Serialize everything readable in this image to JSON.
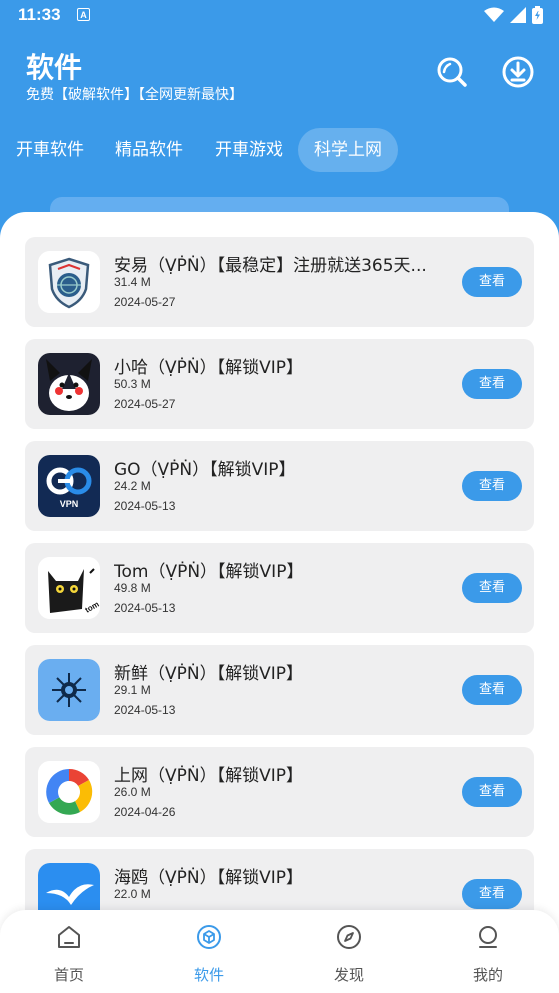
{
  "status": {
    "time": "11:33"
  },
  "header": {
    "title": "软件",
    "subtitle": "免费【破解软件】【全网更新最快】",
    "accent": "#3b9ae9"
  },
  "tabs": [
    {
      "label": "开車软件"
    },
    {
      "label": "精品软件"
    },
    {
      "label": "开車游戏"
    },
    {
      "label": "科学上网",
      "active": true
    }
  ],
  "items": [
    {
      "title": "安易（ṾṖṄ）【最稳定】注册就送365天...",
      "size": "31.4 M",
      "date": "2024-05-27",
      "button": "查看",
      "icon": "shield-globe-icon"
    },
    {
      "title": "小哈（ṾṖṄ）【解锁VIP】",
      "size": "50.3 M",
      "date": "2024-05-27",
      "button": "查看",
      "icon": "husky-icon"
    },
    {
      "title": "GO（ṾṖṄ）【解锁VIP】",
      "size": "24.2 M",
      "date": "2024-05-13",
      "button": "查看",
      "icon": "go-vpn-icon"
    },
    {
      "title": "Tom（ṾṖṄ）【解锁VIP】",
      "size": "49.8 M",
      "date": "2024-05-13",
      "button": "查看",
      "icon": "black-cat-icon"
    },
    {
      "title": "新鲜（ṾṖṄ）【解锁VIP】",
      "size": "29.1 M",
      "date": "2024-05-13",
      "button": "查看",
      "icon": "sun-icon"
    },
    {
      "title": "上网（ṾṖṄ）【解锁VIP】",
      "size": "26.0 M",
      "date": "2024-04-26",
      "button": "查看",
      "icon": "ring-icon"
    },
    {
      "title": "海鸥（ṾṖṄ）【解锁VIP】",
      "size": "22.0 M",
      "date": "",
      "button": "查看",
      "icon": "seagull-icon"
    }
  ],
  "bottom_nav": [
    {
      "label": "首页",
      "icon": "home-icon"
    },
    {
      "label": "软件",
      "icon": "cube-icon",
      "active": true
    },
    {
      "label": "发现",
      "icon": "compass-icon"
    },
    {
      "label": "我的",
      "icon": "user-icon"
    }
  ]
}
